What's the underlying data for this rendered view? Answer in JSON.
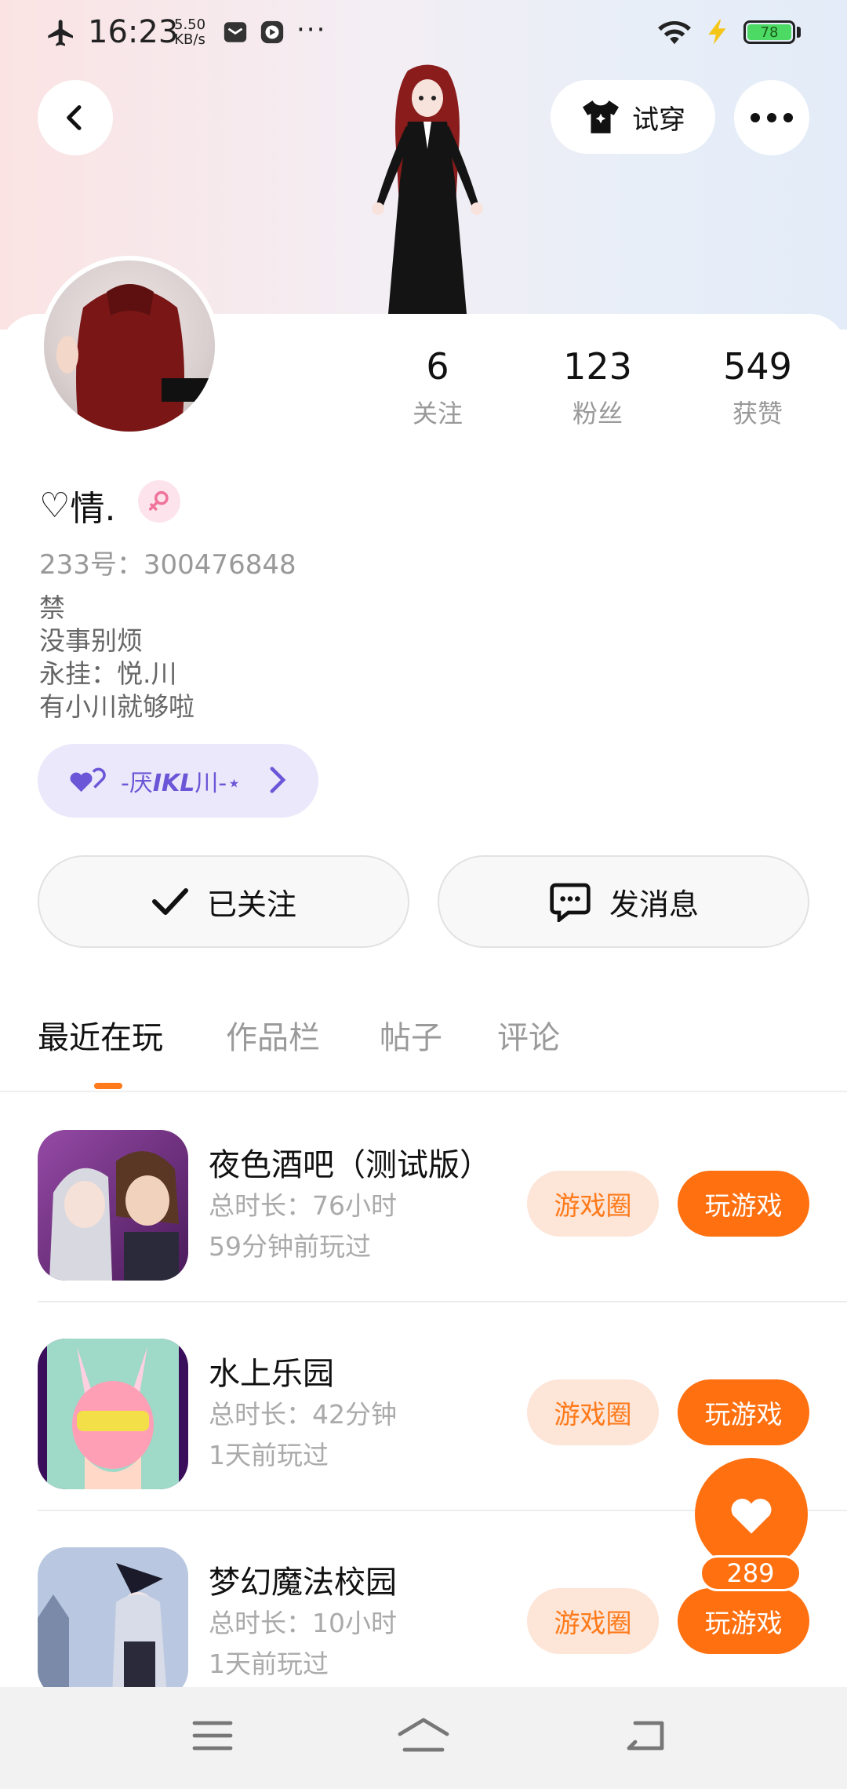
{
  "status_bar": {
    "time": "16:23",
    "speed_value": "5.50",
    "speed_unit": "KB/s",
    "more": "···",
    "battery": "78"
  },
  "header": {
    "back_icon": "chevron-left-icon",
    "try_on_label": "试穿",
    "more_icon": "more-dots-icon"
  },
  "profile": {
    "stats": [
      {
        "value": "6",
        "label": "关注"
      },
      {
        "value": "123",
        "label": "粉丝"
      },
      {
        "value": "549",
        "label": "获赞"
      }
    ],
    "nickname_symbol": "♡",
    "nickname": "情.",
    "gender_icon": "female-icon",
    "uid_label": "233号：",
    "uid": "300476848",
    "bio": [
      "禁",
      "没事别烦",
      "永挂：悦.川",
      "有小川就够啦"
    ],
    "guild_prefix": "-厌",
    "guild_bold": "IKL",
    "guild_suffix": "川-⋆"
  },
  "actions": {
    "follow_label": "已关注",
    "message_label": "发消息"
  },
  "tabs": [
    {
      "label": "最近在玩",
      "active": true
    },
    {
      "label": "作品栏",
      "active": false
    },
    {
      "label": "帖子",
      "active": false
    },
    {
      "label": "评论",
      "active": false
    }
  ],
  "games": [
    {
      "title": "夜色酒吧（测试版）",
      "duration": "总时长：76小时",
      "last_played": "59分钟前玩过"
    },
    {
      "title": "水上乐园",
      "duration": "总时长：42分钟",
      "last_played": "1天前玩过"
    },
    {
      "title": "梦幻魔法校园",
      "duration": "总时长：10小时",
      "last_played": "1天前玩过"
    }
  ],
  "game_buttons": {
    "circle": "游戏圈",
    "play": "玩游戏"
  },
  "like_fab": {
    "count": "289"
  },
  "colors": {
    "accent": "#ff7010",
    "accent_light": "#fde5d8",
    "guild": "#6a56d6"
  }
}
